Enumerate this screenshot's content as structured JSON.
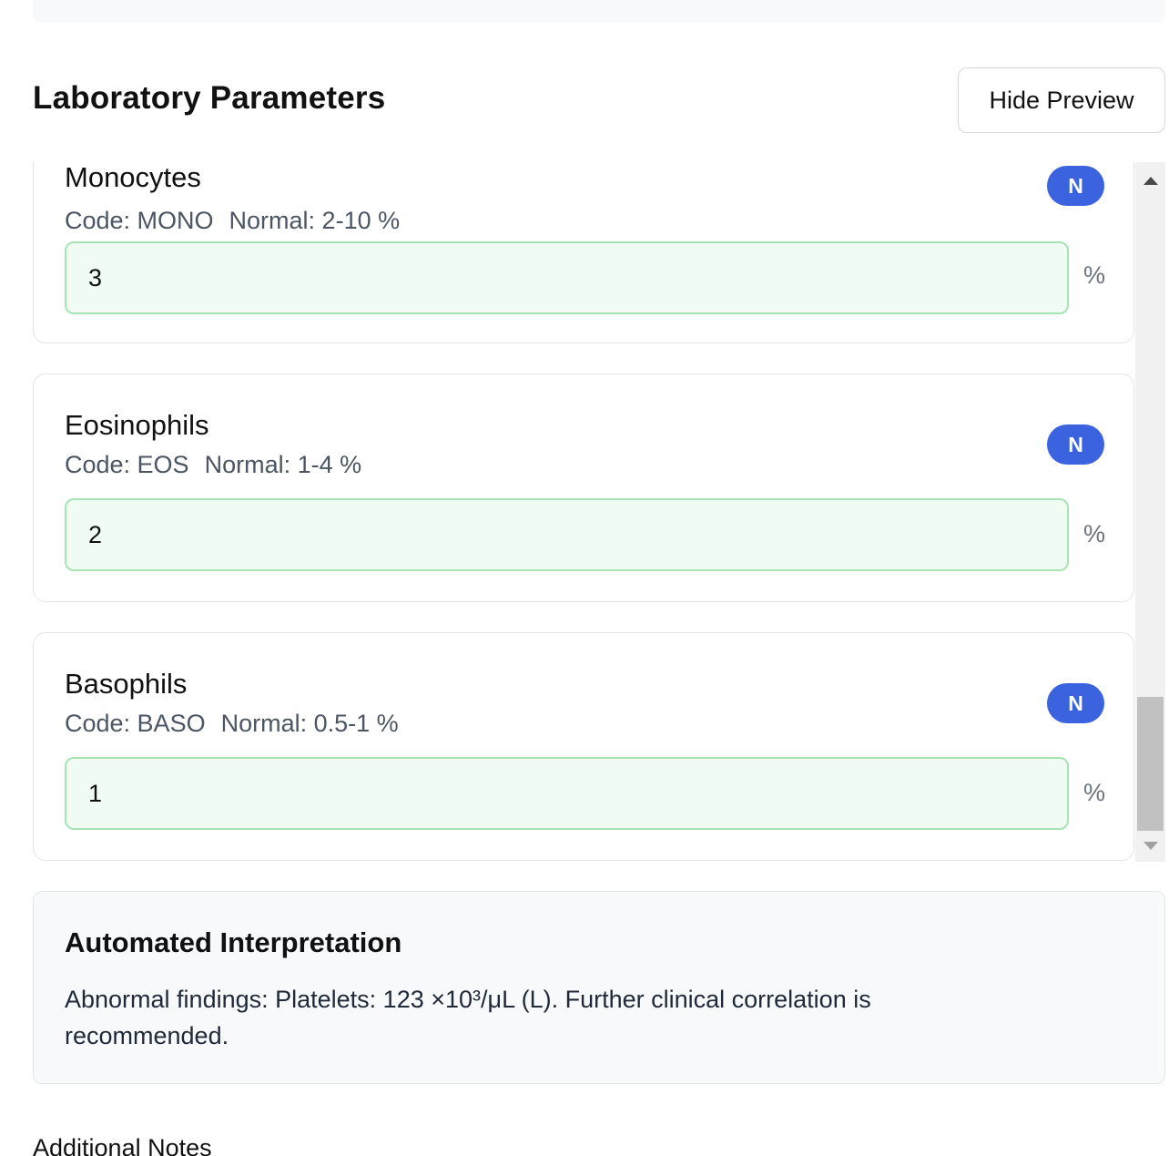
{
  "header": {
    "title": "Laboratory Parameters",
    "hide_preview_label": "Hide Preview"
  },
  "parameters": [
    {
      "name": "Monocytes",
      "code": "Code: MONO",
      "normal": "Normal: 2-10 %",
      "value": "3",
      "unit": "%",
      "status": "N"
    },
    {
      "name": "Eosinophils",
      "code": "Code: EOS",
      "normal": "Normal: 1-4 %",
      "value": "2",
      "unit": "%",
      "status": "N"
    },
    {
      "name": "Basophils",
      "code": "Code: BASO",
      "normal": "Normal: 0.5-1 %",
      "value": "1",
      "unit": "%",
      "status": "N"
    }
  ],
  "interpretation": {
    "title": "Automated Interpretation",
    "text": "Abnormal findings: Platelets: 123 ×10³/μL (L). Further clinical correlation is recommended."
  },
  "notes": {
    "label": "Additional Notes"
  },
  "colors": {
    "status_normal": "#3b63e0",
    "input_border_ok": "#a7e4b4",
    "input_bg_ok": "#f0fbf3"
  }
}
